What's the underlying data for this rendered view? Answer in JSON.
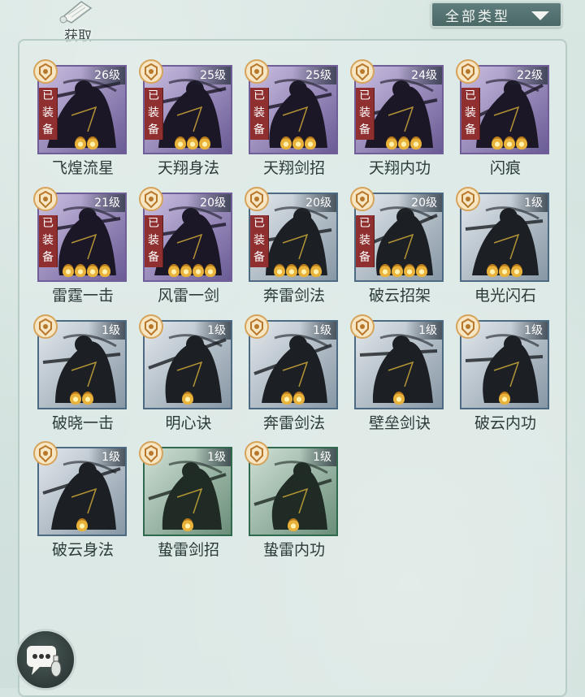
{
  "top": {
    "get_label": "获取",
    "type_filter": "全部类型"
  },
  "skills": [
    {
      "name": "飞煌流星",
      "level": "26级",
      "equipped": true,
      "stars": 2,
      "tier": "purple",
      "equipped_text": [
        "已",
        "装",
        "备"
      ]
    },
    {
      "name": "天翔身法",
      "level": "25级",
      "equipped": true,
      "stars": 3,
      "tier": "purple",
      "equipped_text": [
        "已",
        "装",
        "备"
      ]
    },
    {
      "name": "天翔剑招",
      "level": "25级",
      "equipped": true,
      "stars": 3,
      "tier": "purple",
      "equipped_text": [
        "已",
        "装",
        "备"
      ]
    },
    {
      "name": "天翔内功",
      "level": "24级",
      "equipped": true,
      "stars": 3,
      "tier": "purple",
      "equipped_text": [
        "已",
        "装",
        "备"
      ]
    },
    {
      "name": "闪痕",
      "level": "22级",
      "equipped": true,
      "stars": 3,
      "tier": "purple",
      "equipped_text": [
        "已",
        "装",
        "备"
      ]
    },
    {
      "name": "雷霆一击",
      "level": "21级",
      "equipped": true,
      "stars": 4,
      "tier": "purple",
      "equipped_text": [
        "已",
        "装",
        "备"
      ]
    },
    {
      "name": "风雷一剑",
      "level": "20级",
      "equipped": true,
      "stars": 4,
      "tier": "purple",
      "equipped_text": [
        "已",
        "装",
        "备"
      ]
    },
    {
      "name": "奔雷剑法",
      "level": "20级",
      "equipped": true,
      "stars": 4,
      "tier": "blue",
      "equipped_text": [
        "已",
        "装",
        "备"
      ]
    },
    {
      "name": "破云招架",
      "level": "20级",
      "equipped": true,
      "stars": 4,
      "tier": "blue",
      "equipped_text": [
        "已",
        "装",
        "备"
      ]
    },
    {
      "name": "电光闪石",
      "level": "1级",
      "equipped": false,
      "stars": 3,
      "tier": "blue",
      "equipped_text": []
    },
    {
      "name": "破晓一击",
      "level": "1级",
      "equipped": false,
      "stars": 2,
      "tier": "blue",
      "equipped_text": []
    },
    {
      "name": "明心诀",
      "level": "1级",
      "equipped": false,
      "stars": 1,
      "tier": "blue",
      "equipped_text": []
    },
    {
      "name": "奔雷剑法",
      "level": "1级",
      "equipped": false,
      "stars": 2,
      "tier": "blue",
      "equipped_text": []
    },
    {
      "name": "壁垒剑诀",
      "level": "1级",
      "equipped": false,
      "stars": 1,
      "tier": "blue",
      "equipped_text": []
    },
    {
      "name": "破云内功",
      "level": "1级",
      "equipped": false,
      "stars": 1,
      "tier": "blue",
      "equipped_text": []
    },
    {
      "name": "破云身法",
      "level": "1级",
      "equipped": false,
      "stars": 1,
      "tier": "blue",
      "equipped_text": []
    },
    {
      "name": "蛰雷剑招",
      "level": "1级",
      "equipped": false,
      "stars": 1,
      "tier": "green",
      "equipped_text": []
    },
    {
      "name": "蛰雷内功",
      "level": "1级",
      "equipped": false,
      "stars": 1,
      "tier": "green",
      "equipped_text": []
    }
  ],
  "icons": {
    "get": "scroll-icon",
    "filter_caret": "caret-down-icon",
    "badge": "skill-badge-icon",
    "chat": "chat-bubble-icon"
  },
  "colors": {
    "equipped_tag": "#8f2f2f",
    "star": "#e9b33b",
    "filter_bg": "#4a6866"
  }
}
